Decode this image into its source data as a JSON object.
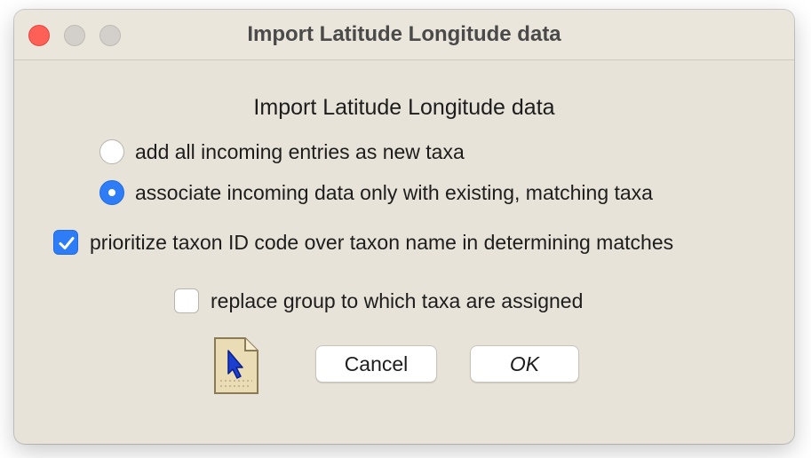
{
  "window": {
    "title": "Import Latitude Longitude data"
  },
  "dialog": {
    "heading": "Import Latitude Longitude data",
    "radio_options": [
      {
        "label": "add all incoming entries as new taxa",
        "selected": false
      },
      {
        "label": "associate incoming data only with existing, matching taxa",
        "selected": true
      }
    ],
    "checkboxes": [
      {
        "label": "prioritize taxon ID code over taxon name in determining matches",
        "checked": true
      },
      {
        "label": "replace group to which taxa are assigned",
        "checked": false
      }
    ],
    "buttons": {
      "cancel": "Cancel",
      "ok": "OK"
    },
    "icons": {
      "document": "document-pointer-icon"
    }
  },
  "colors": {
    "window_bg": "#e8e3d8",
    "accent": "#2f7df6",
    "close": "#fe5f57"
  }
}
